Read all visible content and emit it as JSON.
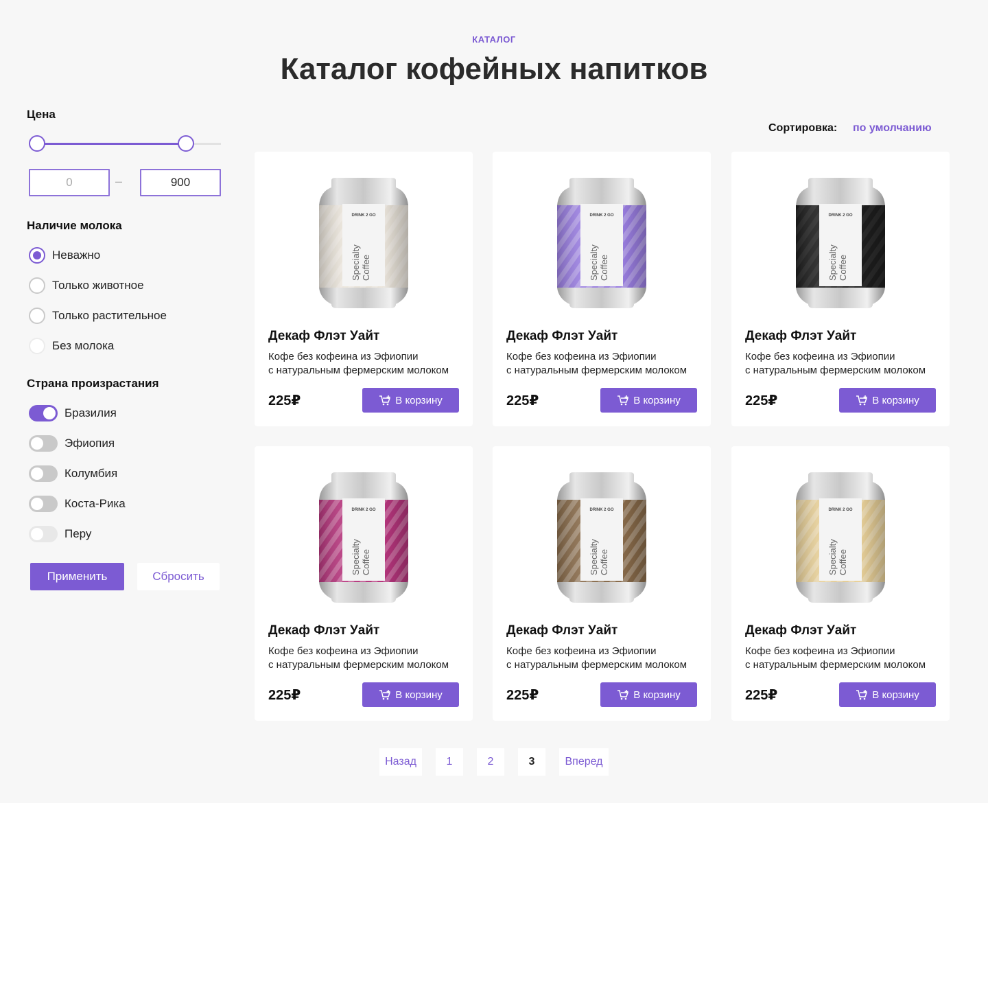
{
  "header": {
    "eyebrow": "КАТАЛОГ",
    "title": "Каталог кофейных напитков"
  },
  "filters": {
    "price": {
      "label": "Цена",
      "min_value": "0",
      "max_value": "900",
      "dash": "–",
      "range_low": 0.0,
      "range_high": 0.84
    },
    "milk": {
      "label": "Наличие молока",
      "options": [
        {
          "label": "Неважно",
          "checked": true
        },
        {
          "label": "Только животное",
          "checked": false
        },
        {
          "label": "Только растительное",
          "checked": false
        },
        {
          "label": "Без молока",
          "checked": false,
          "disabled": true
        }
      ]
    },
    "country": {
      "label": "Страна произрастания",
      "options": [
        {
          "label": "Бразилия",
          "on": true
        },
        {
          "label": "Эфиопия",
          "on": false
        },
        {
          "label": "Колумбия",
          "on": false
        },
        {
          "label": "Коста-Рика",
          "on": false
        },
        {
          "label": "Перу",
          "on": false,
          "disabled": true
        }
      ]
    },
    "apply_label": "Применить",
    "reset_label": "Сбросить"
  },
  "sort": {
    "label": "Сортировка:",
    "value": "по умолчанию"
  },
  "products": [
    {
      "name": "Декаф Флэт Уайт",
      "desc1": "Кофе без кофеина из Эфиопии",
      "desc2": "с натуральным фермерским молоком",
      "price": "225₽",
      "cart_label": "В корзину",
      "color": "#ece6dc"
    },
    {
      "name": "Декаф Флэт Уайт",
      "desc1": "Кофе без кофеина из Эфиопии",
      "desc2": "с натуральным фермерским молоком",
      "price": "225₽",
      "cart_label": "В корзину",
      "color": "#9b7fe3"
    },
    {
      "name": "Декаф Флэт Уайт",
      "desc1": "Кофе без кофеина из Эфиопии",
      "desc2": "с натуральным фермерским молоком",
      "price": "225₽",
      "cart_label": "В корзину",
      "color": "#1e1e1e"
    },
    {
      "name": "Декаф Флэт Уайт",
      "desc1": "Кофе без кофеина из Эфиопии",
      "desc2": "с натуральным фермерским молоком",
      "price": "225₽",
      "cart_label": "В корзину",
      "color": "#b8367e"
    },
    {
      "name": "Декаф Флэт Уайт",
      "desc1": "Кофе без кофеина из Эфиопии",
      "desc2": "с натуральным фермерским молоком",
      "price": "225₽",
      "cart_label": "В корзину",
      "color": "#8a6c4b"
    },
    {
      "name": "Декаф Флэт Уайт",
      "desc1": "Кофе без кофеина из Эфиопии",
      "desc2": "с натуральным фермерским молоком",
      "price": "225₽",
      "cart_label": "В корзину",
      "color": "#ead29a"
    }
  ],
  "can_label": {
    "brand": "DRINK 2 GO",
    "line1": "Specialty",
    "line2": "Coffee"
  },
  "pagination": {
    "prev": "Назад",
    "pages": [
      "1",
      "2",
      "3"
    ],
    "current": "3",
    "next": "Вперед"
  },
  "colors": {
    "accent": "#7c5bd3",
    "background": "#f7f7f7"
  }
}
